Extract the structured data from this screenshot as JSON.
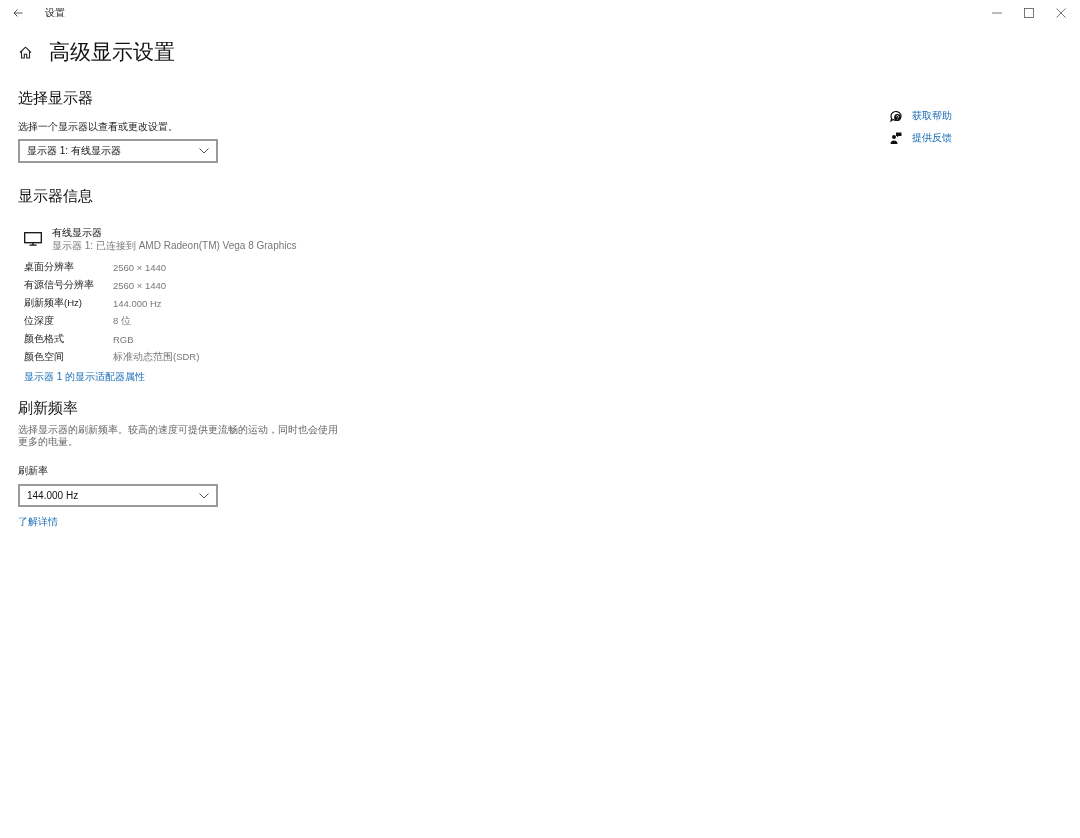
{
  "window": {
    "title": "设置"
  },
  "page": {
    "title": "高级显示设置"
  },
  "select_display": {
    "heading": "选择显示器",
    "description": "选择一个显示器以查看或更改设置。",
    "dropdown": {
      "value": "显示器 1: 有线显示器"
    }
  },
  "display_info": {
    "heading": "显示器信息",
    "monitor": {
      "name": "有线显示器",
      "subtitle": "显示器 1: 已连接到 AMD Radeon(TM) Vega 8 Graphics"
    },
    "rows": [
      {
        "label": "桌面分辨率",
        "value": "2560 × 1440"
      },
      {
        "label": "有源信号分辨率",
        "value": "2560 × 1440"
      },
      {
        "label": "刷新频率(Hz)",
        "value": "144.000 Hz"
      },
      {
        "label": "位深度",
        "value": "8 位"
      },
      {
        "label": "颜色格式",
        "value": "RGB"
      },
      {
        "label": "颜色空间",
        "value": "标准动态范围(SDR)"
      }
    ],
    "link": "显示器 1 的显示适配器属性"
  },
  "refresh_rate": {
    "heading": "刷新频率",
    "description": "选择显示器的刷新频率。较高的速度可提供更流畅的运动，同时也会使用更多的电量。",
    "label": "刷新率",
    "dropdown": {
      "value": "144.000 Hz"
    },
    "link": "了解详情"
  },
  "help_links": [
    {
      "kind": "help",
      "label": "获取帮助"
    },
    {
      "kind": "feedback",
      "label": "提供反馈"
    }
  ]
}
